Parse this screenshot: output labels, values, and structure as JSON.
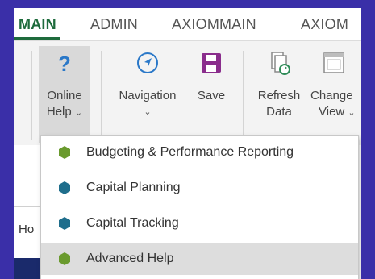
{
  "tabs": [
    {
      "label": "MAIN"
    },
    {
      "label": "ADMIN"
    },
    {
      "label": "AXIOMMAIN"
    },
    {
      "label": "AXIOM"
    }
  ],
  "ribbon": {
    "online_help": {
      "line1": "Online",
      "line2": "Help",
      "icon": "question-mark-icon",
      "color": "#2a78c8"
    },
    "navigation": {
      "label": "Navigation",
      "icon": "compass-arrow-icon",
      "color": "#2a78c8"
    },
    "save": {
      "label": "Save",
      "icon": "floppy-disk-icon",
      "color": "#8a2d8c"
    },
    "refresh_data": {
      "line1": "Refresh",
      "line2": "Data",
      "icon": "refresh-data-icon"
    },
    "change_view": {
      "line1": "Change",
      "line2": "View",
      "icon": "change-view-icon"
    }
  },
  "cell_text": "Ho",
  "menu": {
    "items": [
      {
        "label": "Budgeting & Performance Reporting",
        "icon_color": "#6a9a2e"
      },
      {
        "label": "Capital Planning",
        "icon_color": "#1f6e8c"
      },
      {
        "label": "Capital Tracking",
        "icon_color": "#1f6e8c"
      },
      {
        "label": "Advanced Help",
        "icon_color": "#6a9a2e"
      }
    ]
  }
}
